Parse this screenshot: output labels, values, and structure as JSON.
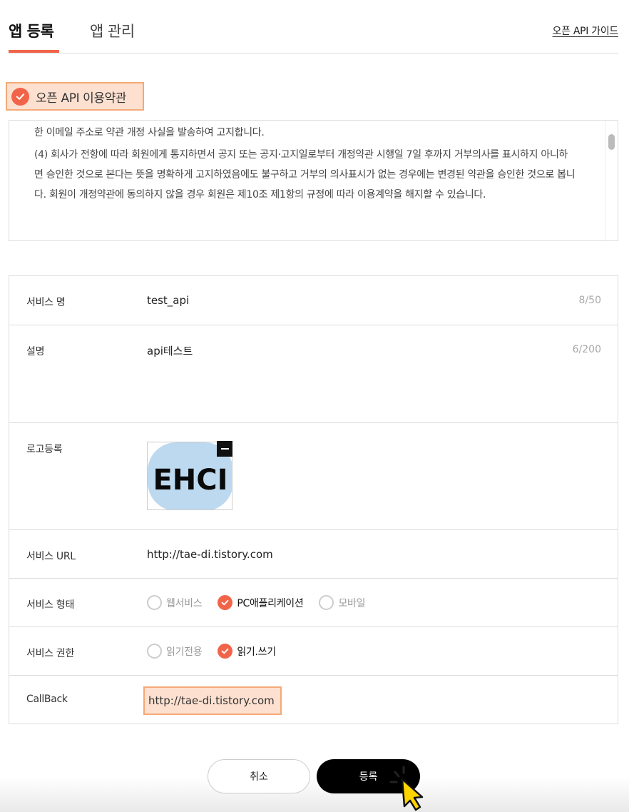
{
  "tabs": [
    {
      "label": "앱 등록",
      "active": true
    },
    {
      "label": "앱 관리",
      "active": false
    }
  ],
  "guide_link": "오픈 API 가이드",
  "terms": {
    "check_label": "오픈 API 이용약관",
    "checked": true,
    "paragraphs": [
      "한 이메일 주소로 약관 개정 사실을 발송하여 고지합니다.",
      "(4) 회사가 전항에 따라 회원에게 통지하면서 공지 또는 공지·고지일로부터 개정약관 시행일 7일 후까지 거부의사를 표시하지 아니하면 승인한 것으로 본다는 뜻을 명확하게 고지하였음에도 불구하고 거부의 의사표시가 없는 경우에는 변경된 약관을 승인한 것으로 봅니다. 회원이 개정약관에 동의하지 않을 경우 회원은 제10조 제1항의 규정에 따라 이용계약을 해지할 수 있습니다."
    ]
  },
  "form": {
    "service_name": {
      "label": "서비스 명",
      "value": "test_api",
      "counter": "8/50"
    },
    "description": {
      "label": "설명",
      "value": "api테스트",
      "counter": "6/200"
    },
    "logo": {
      "label": "로고등록",
      "logo_text": "EHCI"
    },
    "service_url": {
      "label": "서비스 URL",
      "value": "http://tae-di.tistory.com"
    },
    "service_type": {
      "label": "서비스 형태",
      "options": [
        {
          "label": "웹서비스",
          "selected": false
        },
        {
          "label": "PC애플리케이션",
          "selected": true
        },
        {
          "label": "모바일",
          "selected": false
        }
      ]
    },
    "permission": {
      "label": "서비스 권한",
      "options": [
        {
          "label": "읽기전용",
          "selected": false
        },
        {
          "label": "읽기.쓰기",
          "selected": true
        }
      ]
    },
    "callback": {
      "label": "CallBack",
      "value": "http://tae-di.tistory.com"
    }
  },
  "buttons": {
    "cancel": "취소",
    "submit": "등록"
  },
  "colors": {
    "accent": "#f26449",
    "highlight_bg": "#fde0d0",
    "highlight_border": "#f4a977",
    "logo_bg": "#bdd9ef"
  },
  "icons": {
    "check": "check-icon",
    "minus": "minus-icon",
    "cursor": "pointer-cursor-icon"
  }
}
